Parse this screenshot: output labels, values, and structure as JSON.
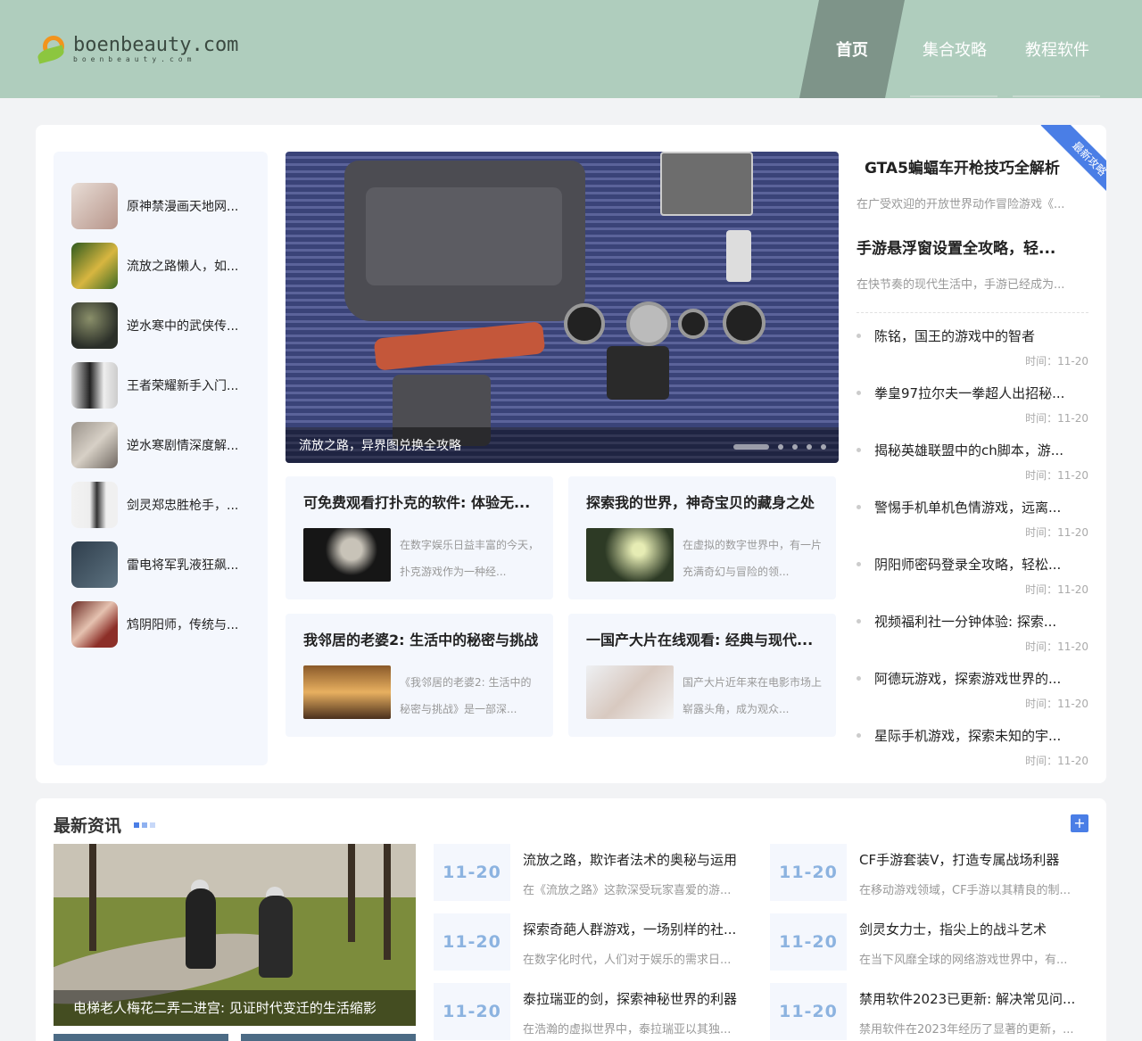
{
  "header": {
    "logo_text": "boenbeauty.com",
    "logo_sub": "boenbeauty.com",
    "nav": [
      "首页",
      "集合攻略",
      "教程软件"
    ]
  },
  "sidebar": {
    "items": [
      {
        "label": "原神禁漫画天地网..."
      },
      {
        "label": "流放之路懒人，如..."
      },
      {
        "label": "逆水寒中的武侠传..."
      },
      {
        "label": "王者荣耀新手入门..."
      },
      {
        "label": "逆水寒剧情深度解..."
      },
      {
        "label": "剑灵郑忠胜枪手，..."
      },
      {
        "label": "雷电将军乳液狂飙..."
      },
      {
        "label": "鸩阴阳师，传统与..."
      }
    ]
  },
  "slider": {
    "caption": "流放之路，异界图兑换全攻略"
  },
  "cards": [
    {
      "title": "可免费观看打扑克的软件: 体验无...",
      "desc": "在数字娱乐日益丰富的今天，扑克游戏作为一种经..."
    },
    {
      "title": "探索我的世界，神奇宝贝的藏身之处",
      "desc": "在虚拟的数字世界中，有一片充满奇幻与冒险的领..."
    },
    {
      "title": "我邻居的老婆2: 生活中的秘密与挑战",
      "desc": "《我邻居的老婆2: 生活中的秘密与挑战》是一部深..."
    },
    {
      "title": "一国产大片在线观看: 经典与现代...",
      "desc": "国产大片近年来在电影市场上崭露头角，成为观众..."
    }
  ],
  "featured": {
    "ribbon": "最新攻略",
    "items": [
      {
        "title": "GTA5蝙蝠车开枪技巧全解析",
        "desc": "在广受欢迎的开放世界动作冒险游戏《..."
      },
      {
        "title": "手游悬浮窗设置全攻略，轻...",
        "desc": "在快节奏的现代生活中，手游已经成为..."
      }
    ]
  },
  "news_list": {
    "time_label": "时间：",
    "items": [
      {
        "title": "陈铭，国王的游戏中的智者",
        "date": "11-20"
      },
      {
        "title": "拳皇97拉尔夫一拳超人出招秘...",
        "date": "11-20"
      },
      {
        "title": "揭秘英雄联盟中的ch脚本，游...",
        "date": "11-20"
      },
      {
        "title": "警惕手机单机色情游戏，远离...",
        "date": "11-20"
      },
      {
        "title": "阴阳师密码登录全攻略，轻松...",
        "date": "11-20"
      },
      {
        "title": "视频福利社一分钟体验: 探索...",
        "date": "11-20"
      },
      {
        "title": "阿德玩游戏，探索游戏世界的...",
        "date": "11-20"
      },
      {
        "title": "星际手机游戏，探索未知的宇...",
        "date": "11-20"
      }
    ]
  },
  "latest": {
    "title": "最新资讯",
    "plus": "+",
    "big_caption": "电梯老人梅花二弄二进宫: 见证时代变迁的生活缩影",
    "items": [
      {
        "date": "11-20",
        "title": "流放之路，欺诈者法术的奥秘与运用",
        "desc": "在《流放之路》这款深受玩家喜爱的游..."
      },
      {
        "date": "11-20",
        "title": "CF手游套装V，打造专属战场利器",
        "desc": "在移动游戏领域，CF手游以其精良的制..."
      },
      {
        "date": "11-20",
        "title": "探索奇葩人群游戏，一场别样的社...",
        "desc": "在数字化时代，人们对于娱乐的需求日..."
      },
      {
        "date": "11-20",
        "title": "剑灵女力士，指尖上的战斗艺术",
        "desc": "在当下风靡全球的网络游戏世界中，有..."
      },
      {
        "date": "11-20",
        "title": "泰拉瑞亚的剑，探索神秘世界的利器",
        "desc": "在浩瀚的虚拟世界中，泰拉瑞亚以其独..."
      },
      {
        "date": "11-20",
        "title": "禁用软件2023已更新: 解决常见问...",
        "desc": "禁用软件在2023年经历了显著的更新，..."
      }
    ]
  },
  "colors": {
    "header_bg": "#afcdbd",
    "nav_active": "#7e9489",
    "accent": "#4a7ee6",
    "date_text": "#8cb3e0"
  }
}
